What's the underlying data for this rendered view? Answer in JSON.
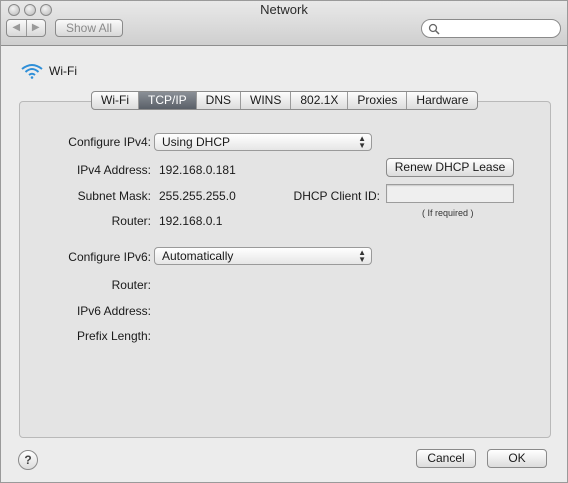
{
  "window": {
    "title": "Network"
  },
  "toolbar": {
    "back_label": "◀",
    "forward_label": "▶",
    "show_all_label": "Show All",
    "search_placeholder": ""
  },
  "header": {
    "interface_name": "Wi-Fi"
  },
  "tabs": [
    {
      "label": "Wi-Fi",
      "active": false
    },
    {
      "label": "TCP/IP",
      "active": true
    },
    {
      "label": "DNS",
      "active": false
    },
    {
      "label": "WINS",
      "active": false
    },
    {
      "label": "802.1X",
      "active": false
    },
    {
      "label": "Proxies",
      "active": false
    },
    {
      "label": "Hardware",
      "active": false
    }
  ],
  "ipv4": {
    "configure_label": "Configure IPv4:",
    "configure_value": "Using DHCP",
    "address_label": "IPv4 Address:",
    "address_value": "192.168.0.181",
    "subnet_label": "Subnet Mask:",
    "subnet_value": "255.255.255.0",
    "router_label": "Router:",
    "router_value": "192.168.0.1",
    "renew_button": "Renew DHCP Lease",
    "client_id_label": "DHCP Client ID:",
    "client_id_value": "",
    "client_id_hint": "( If required )"
  },
  "ipv6": {
    "configure_label": "Configure IPv6:",
    "configure_value": "Automatically",
    "router_label": "Router:",
    "address_label": "IPv6 Address:",
    "prefix_label": "Prefix Length:"
  },
  "footer": {
    "help_label": "?",
    "cancel_label": "Cancel",
    "ok_label": "OK"
  },
  "colors": {
    "active_tab": "#6b7078",
    "window_bg": "#ececec",
    "wifi_icon": "#2f8fd8"
  }
}
